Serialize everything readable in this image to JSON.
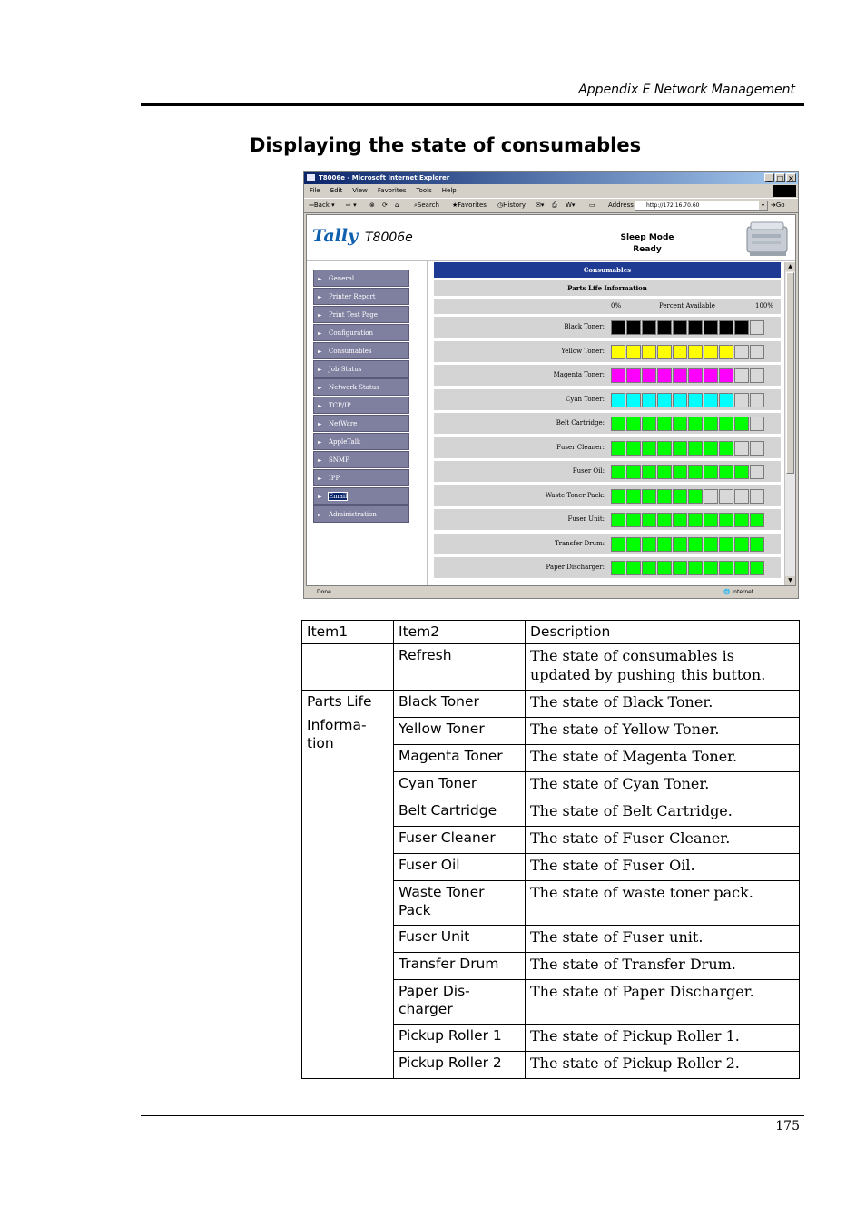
{
  "running_head": "Appendix E Network Management",
  "section_title": "Displaying the state of consumables",
  "browser": {
    "window_title": "T8006e - Microsoft Internet Explorer",
    "menu": [
      "File",
      "Edit",
      "View",
      "Favorites",
      "Tools",
      "Help"
    ],
    "toolbar": {
      "back": "Back",
      "search": "Search",
      "favorites": "Favorites",
      "history": "History",
      "address_label": "Address",
      "address_value": "http://172.16.70.60",
      "go": "Go"
    },
    "brand": "Tally",
    "model": "T8006e",
    "printer_status": [
      "Sleep Mode",
      "Ready"
    ],
    "nav_items": [
      "General",
      "Printer Report",
      "Print Test Page",
      "Configuration",
      "Consumables",
      "Job Status",
      "Network Status",
      "TCP/IP",
      "NetWare",
      "AppleTalk",
      "SNMP",
      "IPP",
      "Email",
      "Administration"
    ],
    "selected_nav": "Email",
    "consumables_title": "Consumables",
    "parts_life_title": "Parts Life Information",
    "scale": {
      "min": "0%",
      "mid": "Percent Available",
      "max": "100%"
    },
    "consumables": [
      {
        "label": "Black Toner:",
        "color": "#000000",
        "filled": 9,
        "total": 10
      },
      {
        "label": "Yellow Toner:",
        "color": "#ffff00",
        "filled": 8,
        "total": 10
      },
      {
        "label": "Magenta Toner:",
        "color": "#ff00ff",
        "filled": 8,
        "total": 10
      },
      {
        "label": "Cyan Toner:",
        "color": "#00ffff",
        "filled": 8,
        "total": 10
      },
      {
        "label": "Belt Cartridge:",
        "color": "#00ff00",
        "filled": 9,
        "total": 10
      },
      {
        "label": "Fuser Cleaner:",
        "color": "#00ff00",
        "filled": 8,
        "total": 10
      },
      {
        "label": "Fuser Oil:",
        "color": "#00ff00",
        "filled": 9,
        "total": 10
      },
      {
        "label": "Waste Toner Pack:",
        "color": "#00ff00",
        "filled": 6,
        "total": 10
      },
      {
        "label": "Fuser Unit:",
        "color": "#00ff00",
        "filled": 10,
        "total": 10
      },
      {
        "label": "Transfer Drum:",
        "color": "#00ff00",
        "filled": 10,
        "total": 10
      },
      {
        "label": "Paper Discharger:",
        "color": "#00ff00",
        "filled": 10,
        "total": 10
      }
    ],
    "status_bar": {
      "left": "Done",
      "right": "Internet"
    }
  },
  "table": {
    "headers": [
      "Item1",
      "Item2",
      "Description"
    ],
    "refresh": {
      "item2": "Refresh",
      "description": "The state of consumables is updated by pushing this button."
    },
    "group_label": [
      "Parts Life",
      "Informa-",
      "tion"
    ],
    "rows": [
      {
        "item2": "Black Toner",
        "description": "The state of Black Toner."
      },
      {
        "item2": "Yellow Toner",
        "description": "The state of Yellow Toner."
      },
      {
        "item2": "Magenta Toner",
        "description": "The state of Magenta Toner."
      },
      {
        "item2": "Cyan Toner",
        "description": "The state of Cyan Toner."
      },
      {
        "item2": "Belt Cartridge",
        "description": "The state of Belt Cartridge."
      },
      {
        "item2": "Fuser Cleaner",
        "description": "The state of Fuser Cleaner."
      },
      {
        "item2": "Fuser Oil",
        "description": "The state of Fuser Oil."
      },
      {
        "item2": "Waste Toner Pack",
        "description": "The state of waste toner pack."
      },
      {
        "item2": "Fuser Unit",
        "description": "The state of Fuser unit."
      },
      {
        "item2": "Transfer Drum",
        "description": "The state of Transfer Drum."
      },
      {
        "item2": "Paper Dis-charger",
        "description": "The state of Paper Discharger."
      },
      {
        "item2": "Pickup Roller 1",
        "description": "The state of Pickup Roller 1."
      },
      {
        "item2": "Pickup Roller 2",
        "description": "The state of Pickup Roller 2."
      }
    ]
  },
  "page_number": "175"
}
